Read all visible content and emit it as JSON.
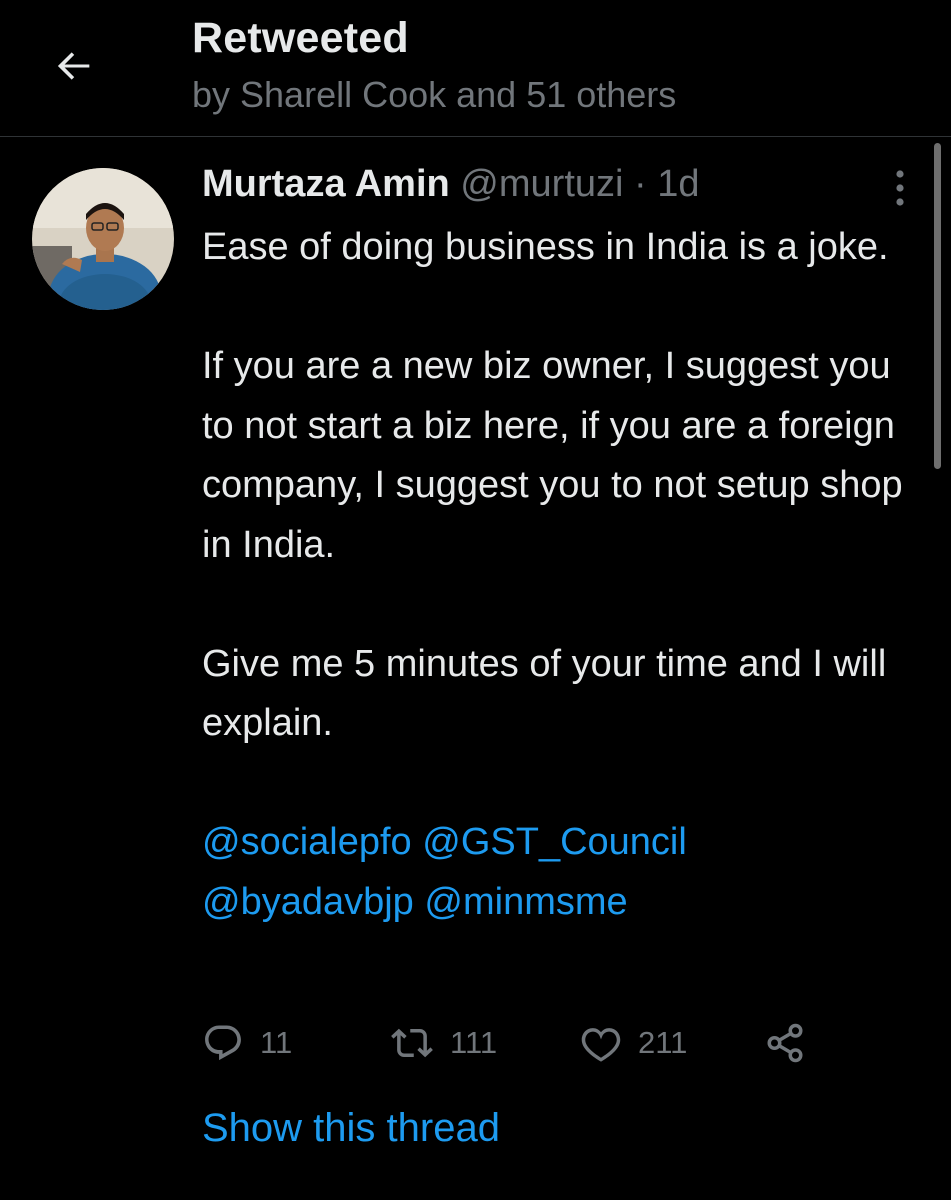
{
  "header": {
    "title": "Retweeted",
    "subtitle": "by Sharell Cook and 51 others",
    "back_icon": "arrow-left-icon"
  },
  "tweet": {
    "author_name": "Murtaza Amin",
    "handle": "@murtuzi",
    "separator": "·",
    "time": "1d",
    "more_icon": "more-vertical-icon",
    "body": {
      "line1": "Ease of doing business in India is a joke.",
      "line2": "If you are a new biz owner, I suggest you to not start a biz here, if you are a foreign company, I suggest you to not setup shop in India.",
      "line3": "Give me 5 minutes of your time and I will explain."
    },
    "mentions": [
      "@socialepfo",
      "@GST_Council",
      "@byadavbjp",
      "@minmsme"
    ],
    "actions": {
      "replies": "11",
      "retweets": "111",
      "likes": "211"
    },
    "show_thread": "Show this thread"
  },
  "colors": {
    "background": "#000000",
    "text": "#e7e9ea",
    "secondary": "#71767b",
    "accent": "#1d9bf0",
    "divider": "#2f3336"
  }
}
